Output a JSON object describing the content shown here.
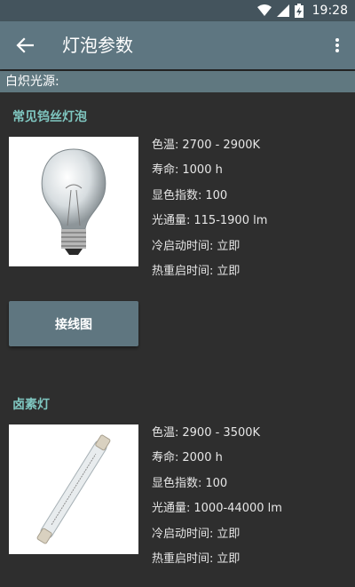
{
  "status_bar": {
    "time": "19:28",
    "icons": [
      "wifi-icon",
      "signal-icon",
      "battery-charging-icon"
    ]
  },
  "app_bar": {
    "title": "灯泡参数",
    "back_icon": "arrow-left-icon",
    "menu_icon": "more-vertical-icon"
  },
  "section": {
    "label": "白炽光源:"
  },
  "cards": [
    {
      "title": "常见钨丝灯泡",
      "image_icon": "incandescent-bulb-image",
      "specs": [
        {
          "label": "色温:",
          "value": "2700 - 2900K"
        },
        {
          "label": "寿命:",
          "value": "1000 h"
        },
        {
          "label": "显色指数:",
          "value": "100"
        },
        {
          "label": "光通量:",
          "value": "115-1900 lm"
        },
        {
          "label": "冷启动时间:",
          "value": "立即"
        },
        {
          "label": "热重启时间:",
          "value": "立即"
        }
      ],
      "button_label": "接线图"
    },
    {
      "title": "卤素灯",
      "image_icon": "halogen-tube-image",
      "specs": [
        {
          "label": "色温:",
          "value": "2900 - 3500K"
        },
        {
          "label": "寿命:",
          "value": "2000 h"
        },
        {
          "label": "显色指数:",
          "value": "100"
        },
        {
          "label": "光通量:",
          "value": "1000-44000 lm"
        },
        {
          "label": "冷启动时间:",
          "value": "立即"
        },
        {
          "label": "热重启时间:",
          "value": "立即"
        }
      ]
    }
  ]
}
